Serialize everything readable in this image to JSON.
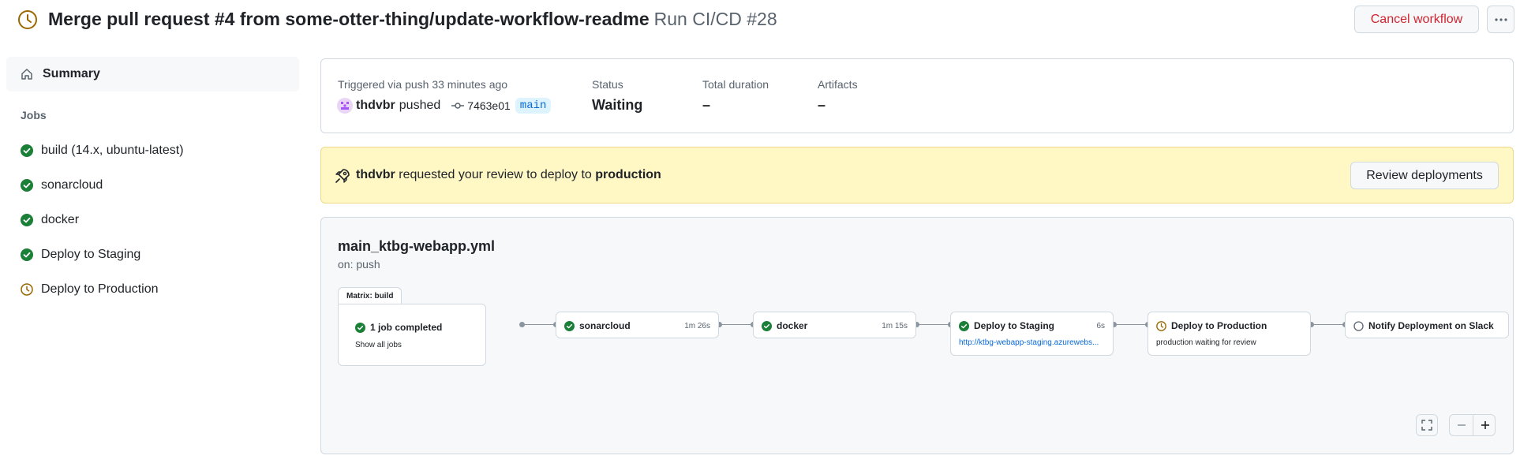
{
  "header": {
    "title": "Merge pull request #4 from some-otter-thing/update-workflow-readme",
    "run": "Run CI/CD #28",
    "cancel_label": "Cancel workflow",
    "more_icon": "kebab-horizontal-icon",
    "status_icon": "clock-icon"
  },
  "sidebar": {
    "summary_label": "Summary",
    "jobs_heading": "Jobs",
    "jobs": [
      {
        "label": "build (14.x, ubuntu-latest)",
        "status": "success"
      },
      {
        "label": "sonarcloud",
        "status": "success"
      },
      {
        "label": "docker",
        "status": "success"
      },
      {
        "label": "Deploy to Staging",
        "status": "success"
      },
      {
        "label": "Deploy to Production",
        "status": "waiting"
      }
    ]
  },
  "info": {
    "triggered_label": "Triggered via push 33 minutes ago",
    "actor": "thdvbr",
    "action": "pushed",
    "commit": "7463e01",
    "branch": "main",
    "status_label": "Status",
    "status_value": "Waiting",
    "duration_label": "Total duration",
    "duration_value": "–",
    "artifacts_label": "Artifacts",
    "artifacts_value": "–"
  },
  "banner": {
    "actor": "thdvbr",
    "text": "requested your review to deploy to",
    "environment": "production",
    "button_label": "Review deployments"
  },
  "graph": {
    "workflow_file": "main_ktbg-webapp.yml",
    "trigger": "on: push",
    "matrix_tab": "Matrix: build",
    "matrix_summary": "1 job completed",
    "matrix_link": "Show all jobs",
    "nodes": [
      {
        "name": "sonarcloud",
        "duration": "1m 26s",
        "status": "success"
      },
      {
        "name": "docker",
        "duration": "1m 15s",
        "status": "success"
      },
      {
        "name": "Deploy to Staging",
        "duration": "6s",
        "status": "success",
        "link": "http://ktbg-webapp-staging.azurewebs..."
      },
      {
        "name": "Deploy to Production",
        "duration": "",
        "status": "waiting",
        "sub": "production waiting for review"
      },
      {
        "name": "Notify Deployment on Slack",
        "duration": "",
        "status": "pending"
      }
    ]
  },
  "colors": {
    "success": "#1a7f37",
    "waiting": "#9a6700",
    "danger": "#d1242f",
    "link": "#0969da",
    "banner_bg": "#fff8c5"
  }
}
